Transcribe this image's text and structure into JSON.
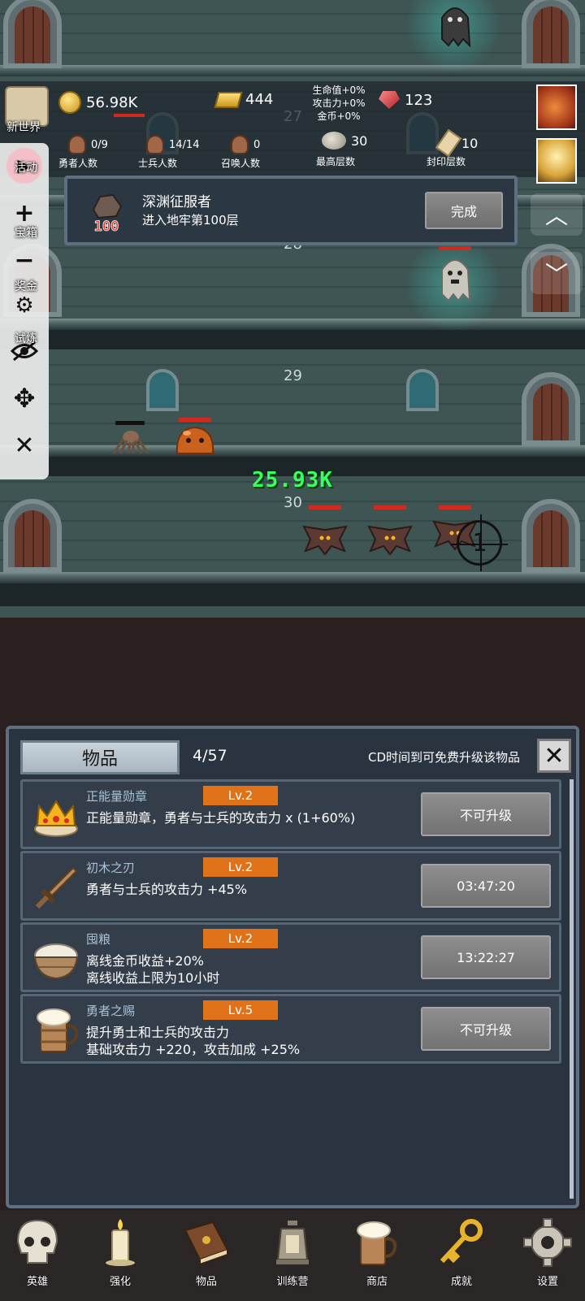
{
  "hud": {
    "coins": "56.98K",
    "gold_bars": "444",
    "gems": "123",
    "buff_hp": "生命值+0%",
    "buff_atk": "攻击力+0%",
    "buff_gold": "金币+0%",
    "hero_count": "0/9",
    "hero_label": "勇者人数",
    "soldier_count": "14/14",
    "soldier_label": "士兵人数",
    "summon_count": "0",
    "summon_label": "召唤人数",
    "highest_floor": "30",
    "highest_label": "最高层数",
    "sealed_floor": "10",
    "sealed_label": "封印层数"
  },
  "side_labels": {
    "new_world": "新世界",
    "activity": "活动",
    "treasure": "宝箱",
    "bonus": "奖金",
    "trial": "试炼"
  },
  "floors": [
    "27",
    "28",
    "29",
    "30"
  ],
  "damage_text": "25.93K",
  "crosshair_num": "1",
  "achievement": {
    "title": "深渊征服者",
    "desc": "进入地牢第100层",
    "badge": "100",
    "button": "完成"
  },
  "panel": {
    "title": "物品",
    "count": "4/57",
    "hint": "CD时间到可免费升级该物品",
    "items": [
      {
        "name": "正能量勋章",
        "level": "Lv.2",
        "desc1": "正能量勋章，勇者与士兵的攻击力 x (1+60%)",
        "desc2": "",
        "action": "不可升级",
        "icon": "crown-icon"
      },
      {
        "name": "初木之刃",
        "level": "Lv.2",
        "desc1": "勇者与士兵的攻击力 +45%",
        "desc2": "",
        "action": "03:47:20",
        "icon": "sword-icon"
      },
      {
        "name": "囤粮",
        "level": "Lv.2",
        "desc1": "离线金币收益+20%",
        "desc2": "离线收益上限为10小时",
        "action": "13:22:27",
        "icon": "rice-bowl-icon"
      },
      {
        "name": "勇者之赐",
        "level": "Lv.5",
        "desc1": "提升勇士和士兵的攻击力",
        "desc2": "基础攻击力 +220，攻击加成 +25%",
        "action": "不可升级",
        "icon": "beer-mug-icon"
      }
    ]
  },
  "nav": [
    {
      "label": "英雄",
      "icon": "skull-icon"
    },
    {
      "label": "强化",
      "icon": "candle-icon"
    },
    {
      "label": "物品",
      "icon": "book-icon"
    },
    {
      "label": "训练营",
      "icon": "lantern-icon"
    },
    {
      "label": "商店",
      "icon": "beer-mug-icon"
    },
    {
      "label": "成就",
      "icon": "key-icon"
    },
    {
      "label": "设置",
      "icon": "gear-icon"
    }
  ],
  "colors": {
    "level_badge": "#e0731a",
    "damage_text": "#3bff5a",
    "hp_bar": "#d02a1f"
  }
}
